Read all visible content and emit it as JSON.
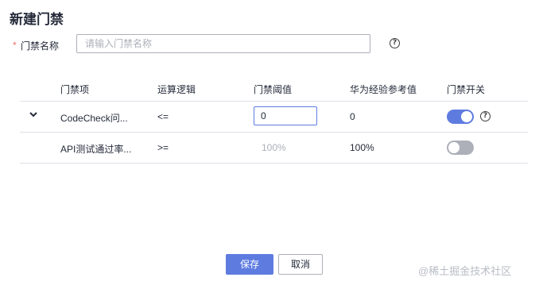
{
  "page": {
    "title": "新建门禁"
  },
  "form": {
    "required_mark": "*",
    "name_label": "门禁名称",
    "name_placeholder": "请输入门禁名称",
    "name_value": ""
  },
  "table": {
    "headers": [
      "门禁项",
      "运算逻辑",
      "门禁阈值",
      "华为经验参考值",
      "门禁开关"
    ],
    "rows": [
      {
        "gate": "CodeCheck问...",
        "operator": "<=",
        "threshold": "0",
        "threshold_editable": true,
        "reference": "0",
        "switch_on": true,
        "has_help": true,
        "expandable": true
      },
      {
        "gate": "API测试通过率...",
        "operator": ">=",
        "threshold": "100%",
        "threshold_editable": false,
        "reference": "100%",
        "switch_on": false,
        "has_help": false,
        "expandable": false
      }
    ]
  },
  "buttons": {
    "save": "保存",
    "cancel": "取消"
  },
  "watermark": "@稀土掘金技术社区",
  "colors": {
    "primary": "#5e7ce0",
    "required": "#f66f6a",
    "border": "#adb0b8",
    "divider": "#dfe1e6",
    "switch_off": "#adb0b8"
  },
  "icons": {
    "help": "question-circle-icon",
    "expand": "chevron-down-icon"
  }
}
